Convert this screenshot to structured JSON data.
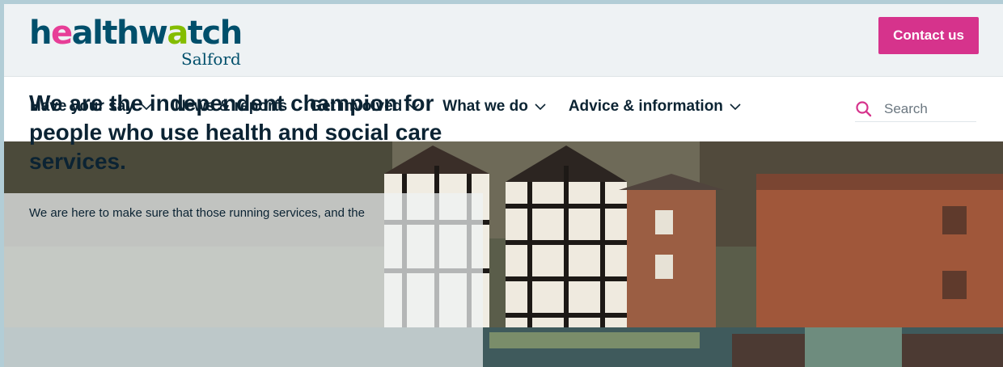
{
  "header": {
    "logo": {
      "word_before": "h",
      "word_accent": "e",
      "word_mid": "althw",
      "word_accent2": "a",
      "word_after": "tch",
      "sub": "Salford"
    },
    "contact_label": "Contact us",
    "colors": {
      "brand": "#004f6b",
      "accent": "#d6338c",
      "lime": "#84bd00"
    }
  },
  "nav": {
    "items": [
      {
        "label": "Have your say",
        "dropdown": true
      },
      {
        "label": "News & reports",
        "dropdown": false
      },
      {
        "label": "Get involved",
        "dropdown": true
      },
      {
        "label": "What we do",
        "dropdown": true
      },
      {
        "label": "Advice & information",
        "dropdown": true
      }
    ],
    "search": {
      "placeholder": "Search",
      "icon": "search-icon"
    }
  },
  "hero": {
    "title": "We are the independent champion for people who use health and social care services.",
    "text": "We are here to make sure that those running services, and the"
  }
}
